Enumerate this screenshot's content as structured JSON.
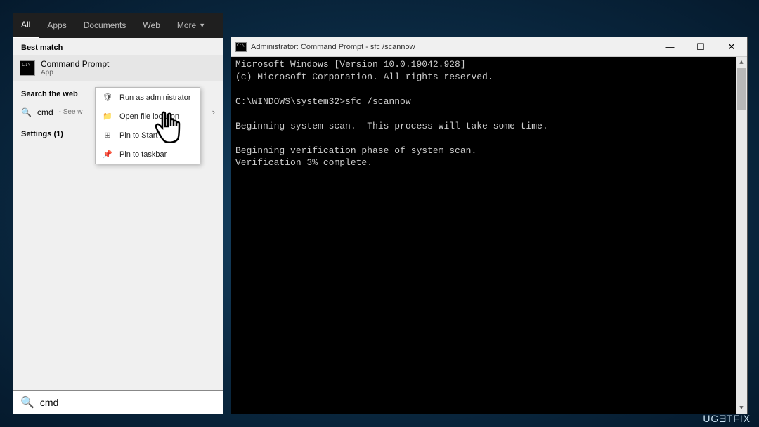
{
  "search": {
    "tabs": {
      "all": "All",
      "apps": "Apps",
      "documents": "Documents",
      "web": "Web",
      "more": "More"
    },
    "best_match_hdr": "Best match",
    "result": {
      "title": "Command Prompt",
      "sub": "App"
    },
    "search_web_hdr": "Search the web",
    "web_row": {
      "query": "cmd",
      "sub": "- See w"
    },
    "settings_hdr": "Settings (1)",
    "context": {
      "run_admin": "Run as administrator",
      "open_loc": "Open file location",
      "pin_start": "Pin to Start",
      "pin_taskbar": "Pin to taskbar"
    },
    "input_value": "cmd"
  },
  "cmd": {
    "title": "Administrator: Command Prompt - sfc  /scannow",
    "lines": {
      "l1": "Microsoft Windows [Version 10.0.19042.928]",
      "l2": "(c) Microsoft Corporation. All rights reserved.",
      "l3": "",
      "l4": "C:\\WINDOWS\\system32>sfc /scannow",
      "l5": "",
      "l6": "Beginning system scan.  This process will take some time.",
      "l7": "",
      "l8": "Beginning verification phase of system scan.",
      "l9": "Verification 3% complete."
    }
  },
  "watermark": "UGETFIX"
}
